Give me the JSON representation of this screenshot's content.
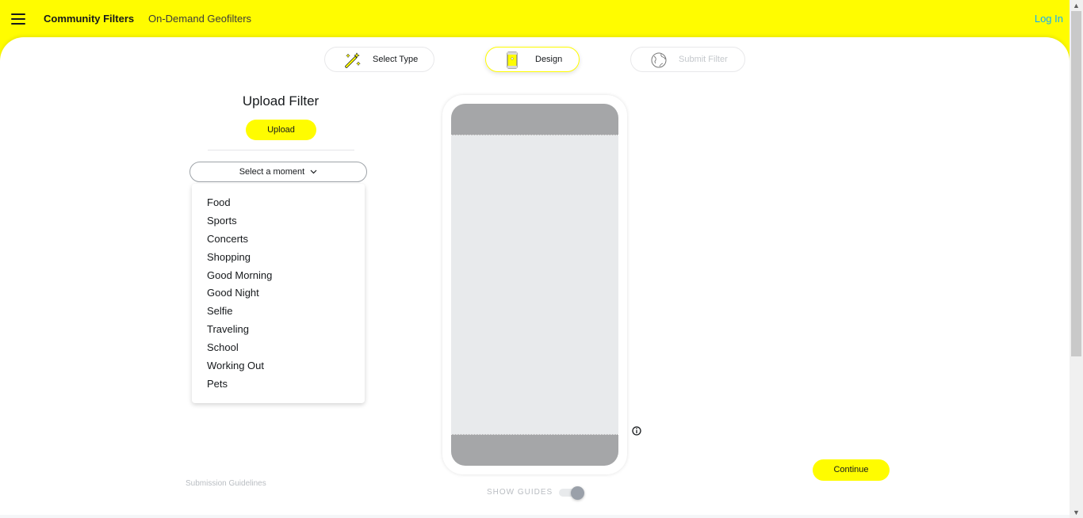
{
  "header": {
    "nav": {
      "community_filters": "Community Filters",
      "on_demand_geofilters": "On-Demand Geofilters"
    },
    "login_label": "Log In"
  },
  "steps": [
    {
      "label": "Select Type",
      "icon": "magic-wand-icon",
      "state": "completed"
    },
    {
      "label": "Design",
      "icon": "phone-icon",
      "state": "active"
    },
    {
      "label": "Submit Filter",
      "icon": "globe-icon",
      "state": "disabled"
    }
  ],
  "upload": {
    "title": "Upload Filter",
    "button_label": "Upload"
  },
  "moment_select": {
    "label": "Select a moment",
    "options": [
      "Food",
      "Sports",
      "Concerts",
      "Shopping",
      "Good Morning",
      "Good Night",
      "Selfie",
      "Traveling",
      "School",
      "Working Out",
      "Pets"
    ]
  },
  "links": {
    "submission_guidelines": "Submission Guidelines"
  },
  "preview": {
    "show_guides_label": "SHOW GUIDES",
    "show_guides_on": true
  },
  "continue_label": "Continue",
  "colors": {
    "brand_yellow": "#fffc00",
    "link_blue": "#0eadff",
    "guide_gray": "#a5a6a8"
  }
}
